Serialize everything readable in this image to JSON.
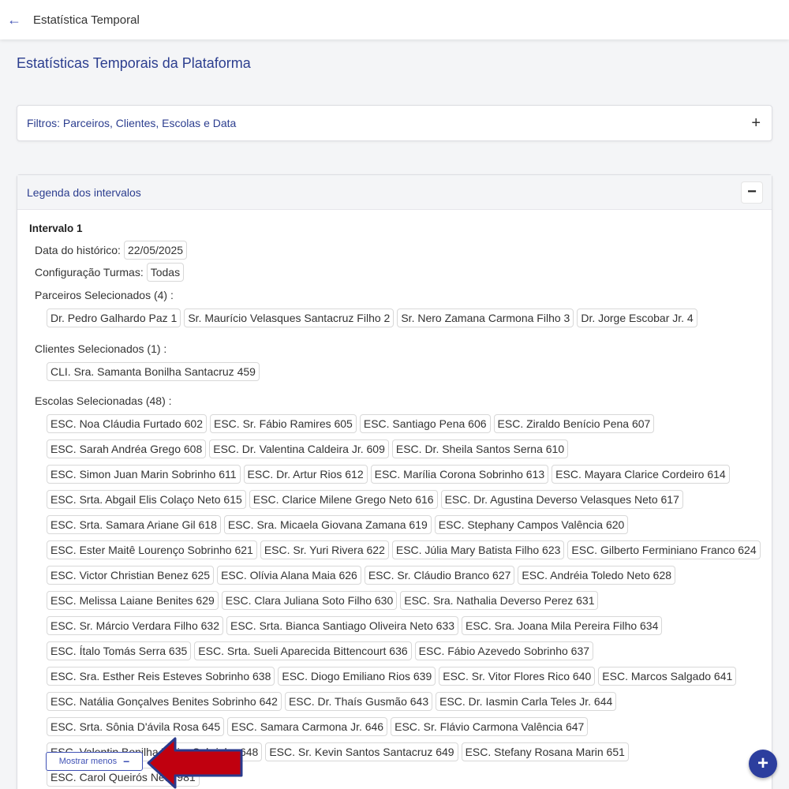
{
  "topbar": {
    "back_icon": "arrow-left-icon",
    "title": "Estatística Temporal"
  },
  "page_title": "Estatísticas Temporais da Plataforma",
  "filters": {
    "title": "Filtros: Parceiros, Clientes, Escolas e Data",
    "toggle": "+"
  },
  "legend": {
    "title": "Legenda dos intervalos",
    "toggle": "−",
    "interval_title": "Intervalo 1",
    "data_label": "Data do histórico:",
    "data_value": "22/05/2025",
    "config_label": "Configuração Turmas:",
    "config_value": "Todas",
    "parceiros_label": "Parceiros Selecionados (4) :",
    "parceiros": [
      "Dr. Pedro Galhardo Paz 1",
      "Sr. Maurício Velasques Santacruz Filho 2",
      "Sr. Nero Zamana Carmona Filho 3",
      "Dr. Jorge Escobar Jr. 4"
    ],
    "clientes_label": "Clientes Selecionados (1) :",
    "clientes": [
      "CLI. Sra. Samanta Bonilha Santacruz 459"
    ],
    "escolas_label": "Escolas Selecionadas (48) :",
    "escolas": [
      "ESC. Noa Cláudia Furtado 602",
      "ESC. Sr. Fábio Ramires 605",
      "ESC. Santiago Pena 606",
      "ESC. Ziraldo Benício Pena 607",
      "ESC. Sarah Andréa Grego 608",
      "ESC. Dr. Valentina Caldeira Jr. 609",
      "ESC. Dr. Sheila Santos Serna 610",
      "ESC. Simon Juan Marin Sobrinho 611",
      "ESC. Dr. Artur Rios 612",
      "ESC. Marília Corona Sobrinho 613",
      "ESC. Mayara Clarice Cordeiro 614",
      "ESC. Srta. Abgail Elis Colaço Neto 615",
      "ESC. Clarice Milene Grego Neto 616",
      "ESC. Dr. Agustina Deverso Velasques Neto 617",
      "ESC. Srta. Samara Ariane Gil 618",
      "ESC. Sra. Micaela Giovana Zamana 619",
      "ESC. Stephany Campos Valência 620",
      "ESC. Ester Maitê Lourenço Sobrinho 621",
      "ESC. Sr. Yuri Rivera 622",
      "ESC. Júlia Mary Batista Filho 623",
      "ESC. Gilberto Ferminiano Franco 624",
      "ESC. Victor Christian Benez 625",
      "ESC. Olívia Alana Maia 626",
      "ESC. Sr. Cláudio Branco 627",
      "ESC. Andréia Toledo Neto 628",
      "ESC. Melissa Laiane Benites 629",
      "ESC. Clara Juliana Soto Filho 630",
      "ESC. Sra. Nathalia Deverso Perez 631",
      "ESC. Sr. Márcio Verdara Filho 632",
      "ESC. Srta. Bianca Santiago Oliveira Neto 633",
      "ESC. Sra. Joana Mila Pereira Filho 634",
      "ESC. Ítalo Tomás Serra 635",
      "ESC. Srta. Sueli Aparecida Bittencourt 636",
      "ESC. Fábio Azevedo Sobrinho 637",
      "ESC. Sra. Esther Reis Esteves Sobrinho 638",
      "ESC. Diogo Emiliano Rios 639",
      "ESC. Sr. Vitor Flores Rico 640",
      "ESC. Marcos Salgado 641",
      "ESC. Natália Gonçalves Benites Sobrinho 642",
      "ESC. Dr. Thaís Gusmão 643",
      "ESC. Dr. Iasmin Carla Teles Jr. 644",
      "ESC. Srta. Sônia D'ávila Rosa 645",
      "ESC. Samara Carmona Jr. 646",
      "ESC. Sr. Flávio Carmona Valência 647",
      "ESC. Valentin Bonilha Vieira Sobrinho 648",
      "ESC. Sr. Kevin Santos Santacruz 649",
      "ESC. Stefany Rosana Marin 651",
      "ESC. Carol Queirós Neto 981"
    ],
    "show_less": "Mostrar menos",
    "show_less_icon": "−"
  },
  "fab": {
    "icon": "plus-icon",
    "label": "+"
  },
  "colors": {
    "primary": "#2c3e8f",
    "arrow_fill": "#c0000f",
    "arrow_outline": "#2a3a8c"
  }
}
